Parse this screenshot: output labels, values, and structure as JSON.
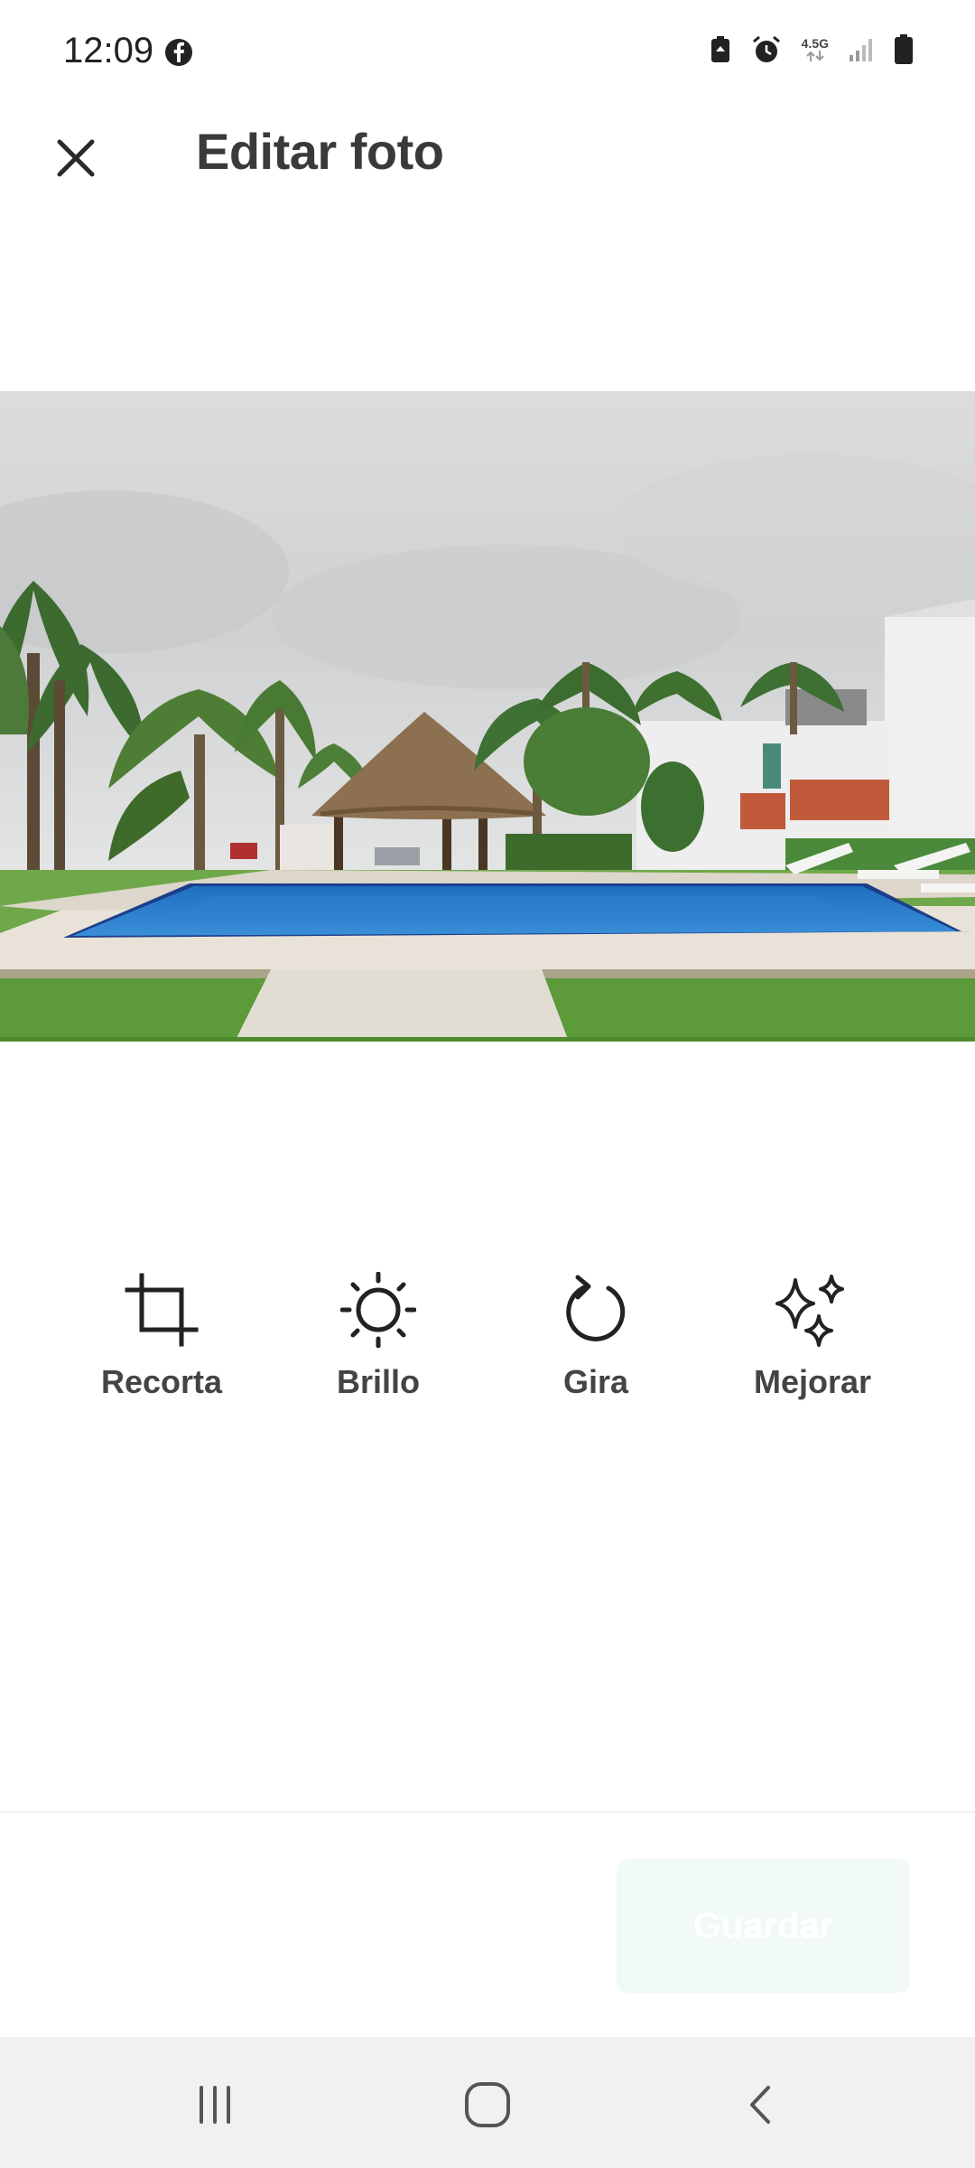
{
  "status_bar": {
    "time": "12:09",
    "network": "4.5G",
    "icons": [
      "facebook-icon",
      "battery-saver-icon",
      "alarm-icon",
      "data-icon",
      "signal-icon",
      "battery-icon"
    ]
  },
  "header": {
    "title": "Editar foto",
    "close_icon": "close-icon"
  },
  "photo": {
    "description_icon": "pool-photo"
  },
  "tools": [
    {
      "label": "Recorta",
      "icon": "crop-icon"
    },
    {
      "label": "Brillo",
      "icon": "brightness-icon"
    },
    {
      "label": "Gira",
      "icon": "rotate-icon"
    },
    {
      "label": "Mejorar",
      "icon": "sparkles-icon"
    }
  ],
  "footer": {
    "save_label": "Guardar"
  },
  "nav": {
    "icons": [
      "recent-apps-icon",
      "home-icon",
      "back-icon"
    ]
  },
  "colors": {
    "text": "#3a3a3a",
    "save_bg": "#f1f9f9",
    "navbar_bg": "#f1f1f1"
  }
}
